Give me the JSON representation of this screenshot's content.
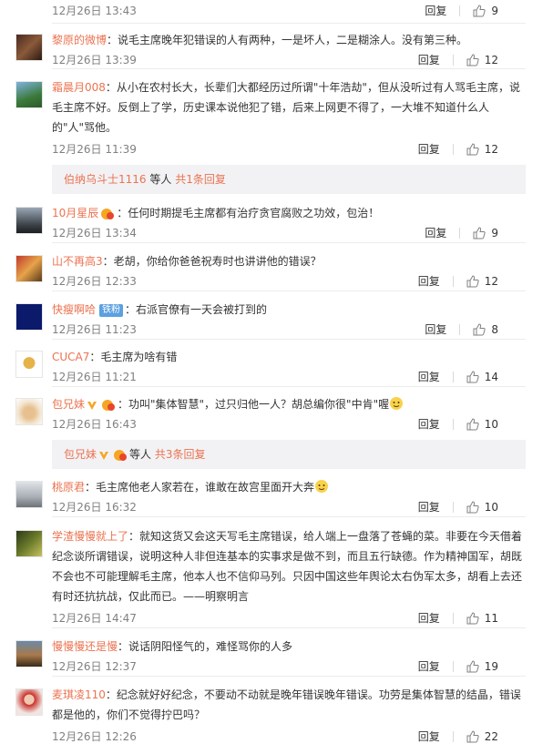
{
  "top_row": {
    "time": "12月26日 13:43",
    "reply": "回复",
    "likes": "9"
  },
  "comments": [
    {
      "user": "黎原的微博",
      "text": "：说毛主席晚年犯错误的人有两种，一是坏人，二是糊涂人。没有第三种。",
      "time": "12月26日 13:39",
      "reply": "回复",
      "likes": "12"
    },
    {
      "user": "霜晨月008",
      "text": "：从小在农村长大，长辈们大都经历过所谓\"十年浩劫\"，但从没听过有人骂毛主席，说毛主席不好。反倒上了学，历史课本说他犯了错，后来上网更不得了，一大堆不知道什么人的\"人\"骂他。",
      "time": "12月26日 11:39",
      "reply": "回复",
      "likes": "12"
    },
    {
      "user": "10月星辰",
      "text": "：任何时期提毛主席都有治疗贪官腐败之功效，包治！",
      "time": "12月26日 13:34",
      "reply": "回复",
      "likes": "9"
    },
    {
      "user": "山不再高3",
      "text": "：老胡，你给你爸爸祝寿时也讲讲他的错误？",
      "time": "12月26日 12:33",
      "reply": "回复",
      "likes": "12"
    },
    {
      "user": "快瘦啊哈",
      "badge": "铁粉",
      "text": "：右派官僚有一天会被打到的",
      "time": "12月26日 11:23",
      "reply": "回复",
      "likes": "8"
    },
    {
      "user": "CUCA7",
      "text": "：毛主席为啥有错",
      "time": "12月26日 11:21",
      "reply": "回复",
      "likes": "14"
    },
    {
      "user": "包兄妹",
      "text": "：功叫\"集体智慧\"，过只归他一人？胡总编你很\"中肯\"喔",
      "time": "12月26日 16:43",
      "reply": "回复",
      "likes": "10"
    },
    {
      "user": "桃原君",
      "text": "：毛主席他老人家若在，谁敢在故宫里面开大奔",
      "time": "12月26日 16:32",
      "reply": "回复",
      "likes": "10"
    },
    {
      "user": "学渣慢慢就上了",
      "text": "：就知这货又会这天写毛主席错误，给人端上一盘落了苍蝇的菜。非要在今天借着纪念谈所谓错误，说明这种人非但连基本的实事求是做不到，而且五行缺德。作为精神国军，胡既不会也不可能理解毛主席，他本人也不信仰马列。只因中国这些年舆论太右伪军太多，胡看上去还有时还抗抗战，仅此而已。——明察明言",
      "time": "12月26日 14:47",
      "reply": "回复",
      "likes": "11"
    },
    {
      "user": "慢慢慢还是慢",
      "text": "：说话阴阳怪气的，难怪骂你的人多",
      "time": "12月26日 12:37",
      "reply": "回复",
      "likes": "19"
    },
    {
      "user": "麦琪凌110",
      "text": "：纪念就好好纪念，不要动不动就是晚年错误晚年错误。功劳是集体智慧的结晶，错误都是他的，你们不觉得拧巴吗？",
      "time": "12月26日 12:26",
      "reply": "回复",
      "likes": "22"
    }
  ],
  "more_replies": [
    {
      "user": "伯纳乌斗士1116",
      "mid": " 等人 ",
      "link": "共1条回复"
    },
    {
      "user": "包兄妹",
      "mid": "等人 ",
      "link": "共3条回复"
    }
  ],
  "colors": {
    "accent": "#eb7350",
    "muted": "#808080",
    "panel": "#f2f2f5"
  },
  "icons": {
    "like": "thumb-up-icon",
    "verified": "v-badge-icon",
    "fan": "fan-badge-icon"
  }
}
